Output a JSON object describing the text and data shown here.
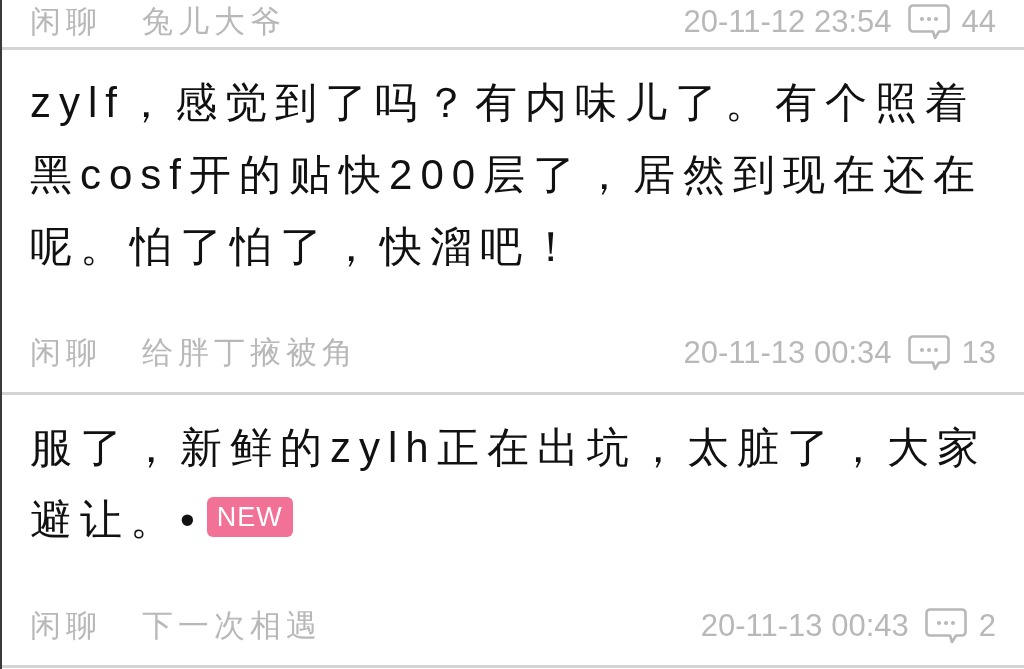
{
  "posts": [
    {
      "category": "闲聊",
      "author": "兔儿大爷",
      "time": "20-11-12 23:54",
      "replies": "44"
    },
    {
      "title": "zylf，感觉到了吗？有内味儿了。有个照着黑cosf开的贴快200层了，居然到现在还在呢。怕了怕了，快溜吧！",
      "category": "闲聊",
      "author": "给胖丁掖被角",
      "time": "20-11-13 00:34",
      "replies": "13"
    },
    {
      "title": "服了，新鲜的zylh正在出坑，太脏了，大家避让。•",
      "badge": "NEW",
      "category": "闲聊",
      "author": "下一次相遇",
      "time": "20-11-13 00:43",
      "replies": "2"
    }
  ]
}
